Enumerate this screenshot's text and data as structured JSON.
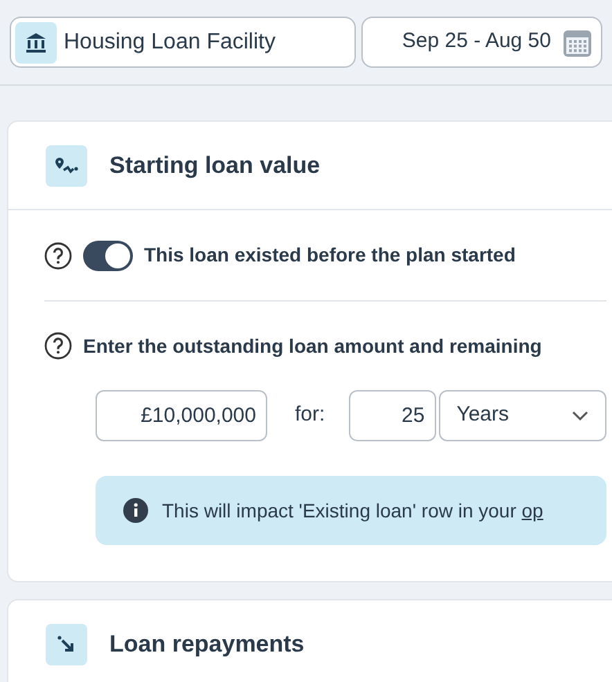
{
  "facility": {
    "name": "Housing Loan Facility",
    "date_range": "Sep 25 - Aug 50"
  },
  "sections": [
    {
      "title": "Starting loan value",
      "kind": "start"
    },
    {
      "title": "Loan repayments",
      "kind": "repay"
    }
  ],
  "toggle": {
    "label": "This loan existed before the plan started",
    "on": true
  },
  "question": "Enter the outstanding loan amount and remaining",
  "amount": "£10,000,000",
  "for_label": "for:",
  "term": "25",
  "unit": "Years",
  "info": {
    "text": "This will impact 'Existing loan' row in your ",
    "link": "op"
  }
}
